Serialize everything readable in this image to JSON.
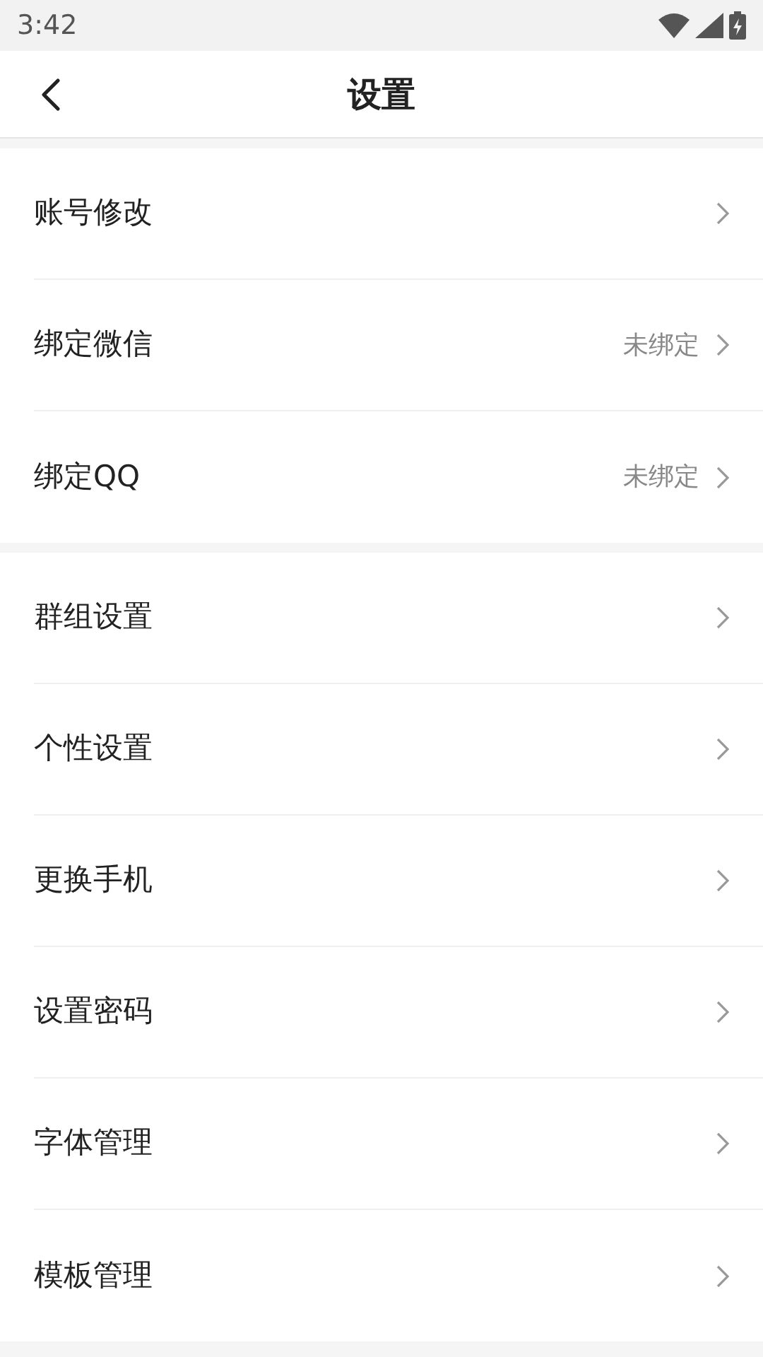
{
  "status_bar": {
    "time": "3:42"
  },
  "header": {
    "title": "设置"
  },
  "groups": [
    {
      "items": [
        {
          "label": "账号修改"
        },
        {
          "label": "绑定微信",
          "value": "未绑定"
        },
        {
          "label": "绑定QQ",
          "value": "未绑定"
        }
      ]
    },
    {
      "items": [
        {
          "label": "群组设置"
        },
        {
          "label": "个性设置"
        },
        {
          "label": "更换手机"
        },
        {
          "label": "设置密码"
        },
        {
          "label": "字体管理"
        },
        {
          "label": "模板管理"
        }
      ]
    }
  ]
}
